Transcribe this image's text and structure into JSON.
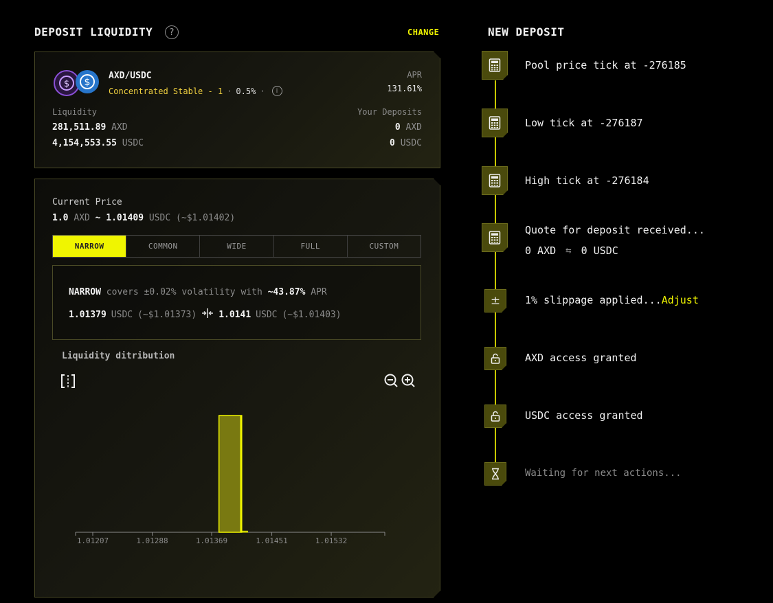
{
  "header": {
    "title": "DEPOSIT LIQUIDITY",
    "help": "?",
    "change_label": "CHANGE"
  },
  "pool": {
    "pair": "AXD/USDC",
    "type_label": "Concentrated Stable - 1",
    "dot": "·",
    "fee": "0.5%",
    "apr_label": "APR",
    "apr_value": "131.61%",
    "liquidity_label": "Liquidity",
    "liq_axd": "281,511.89",
    "liq_axd_unit": "AXD",
    "liq_usdc": "4,154,553.55",
    "liq_usdc_unit": "USDC",
    "your_deposits_label": "Your Deposits",
    "dep_axd": "0",
    "dep_axd_unit": "AXD",
    "dep_usdc": "0",
    "dep_usdc_unit": "USDC",
    "token_colors": {
      "axd": "#8a4fd6",
      "usdc": "#2775ca"
    }
  },
  "price": {
    "label": "Current Price",
    "base_amount": "1.0",
    "base_unit": "AXD",
    "tilde": "~",
    "quote_amount": "1.01409",
    "quote_unit": "USDC",
    "quote_usd": "(~$1.01402)"
  },
  "tabs": [
    "NARROW",
    "COMMON",
    "WIDE",
    "FULL",
    "CUSTOM"
  ],
  "active_tab": "NARROW",
  "range": {
    "name": "NARROW",
    "covers_text": "covers ±0.02% volatility with",
    "apr": "~43.87%",
    "apr_label": "APR",
    "low": "1.01379",
    "low_unit": "USDC",
    "low_usd": "(~$1.01373)",
    "high": "1.0141",
    "high_unit": "USDC",
    "high_usd": "(~$1.01403)"
  },
  "distribution": {
    "title": "Liquidity ditribution"
  },
  "chart_data": {
    "type": "bar",
    "title": "Liquidity ditribution",
    "xlabel": "",
    "ylabel": "",
    "x_ticks": [
      "1.01207",
      "1.01288",
      "1.01369",
      "1.01451",
      "1.01532"
    ],
    "bars": [
      {
        "x_start": 1.01379,
        "x_end": 1.0141,
        "height": 1.0
      },
      {
        "x_start": 1.0141,
        "x_end": 1.01418,
        "height": 0.01
      }
    ],
    "current_price": 1.01409,
    "range_fill": "#6b6b10",
    "bar_color": "#8a8a12",
    "highlight_color": "#f0f500"
  },
  "new_deposit": {
    "title": "NEW DEPOSIT",
    "steps": [
      {
        "icon": "calculator-icon",
        "text": "Pool price tick at -276185"
      },
      {
        "icon": "calculator-icon",
        "text": "Low tick at -276187"
      },
      {
        "icon": "calculator-icon",
        "text": "High tick at -276184"
      },
      {
        "icon": "calculator-icon",
        "text": "Quote for deposit received...",
        "amount_axd": "0 AXD",
        "swap": "⇆",
        "amount_usdc": "0 USDC"
      },
      {
        "icon": "plus-minus-icon",
        "text": "1% slippage applied...",
        "link": "Adjust"
      },
      {
        "icon": "unlock-icon",
        "text": "AXD access granted"
      },
      {
        "icon": "unlock-icon",
        "text": "USDC access granted"
      },
      {
        "icon": "hourglass-icon",
        "text": "Waiting for next actions..."
      }
    ]
  }
}
